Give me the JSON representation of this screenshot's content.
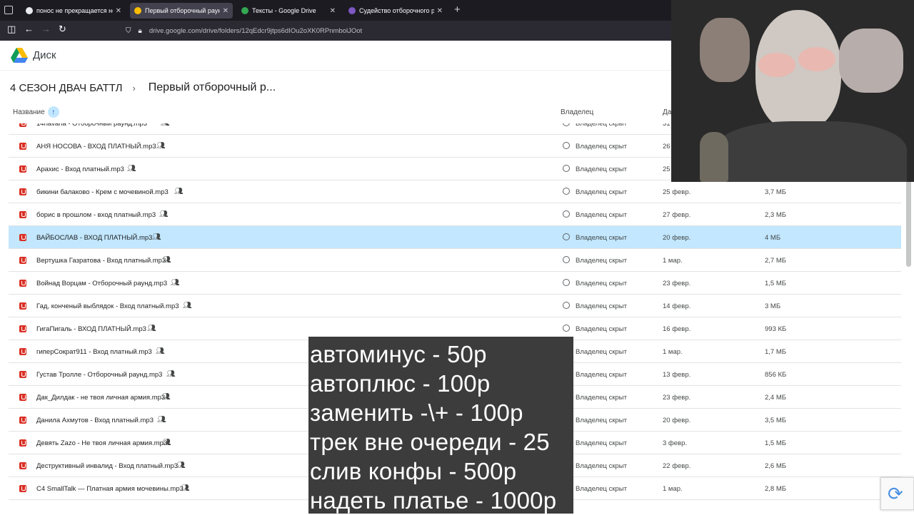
{
  "browser": {
    "tabs": [
      {
        "title": "понос не прекращается неде",
        "favicon_color": "#e8eaed",
        "active": false
      },
      {
        "title": "Первый отборочный раунд – ",
        "favicon_color": "#fbbc04",
        "active": true
      },
      {
        "title": "Тексты - Google Drive",
        "favicon_color": "#34a853",
        "active": false
      },
      {
        "title": "Судейство отборочного раун",
        "favicon_color": "#7e57c2",
        "active": false
      }
    ],
    "url": "drive.google.com/drive/folders/12qEdcr9jtps6dIOu2oXK0RPnmbolJOot"
  },
  "drive": {
    "app_name": "Диск",
    "breadcrumb": {
      "parent": "4 СЕЗОН ДВАЧ БАТТЛ",
      "separator": "›",
      "current": "Первый отборочный р..."
    },
    "columns": {
      "name": "Название",
      "owner": "Владелец",
      "date": "Да"
    },
    "sort_icon": "arrow-up-icon",
    "rows": [
      {
        "name": "14havana - Отборочный раунд.mp3",
        "owner": "Владелец скрыт",
        "date": "31",
        "size": ""
      },
      {
        "name": "АНЯ НОСОВА - ВХОД ПЛАТНЫЙ.mp3",
        "owner": "Владелец скрыт",
        "date": "26",
        "size": ""
      },
      {
        "name": "Арахис - Вход платный.mp3",
        "owner": "Владелец скрыт",
        "date": "25",
        "size": ""
      },
      {
        "name": "бикини балаково - Крем с мочевиной.mp3",
        "owner": "Владелец скрыт",
        "date": "25 февр.",
        "size": "3,7 МБ"
      },
      {
        "name": "борис в прошлом - вход платный.mp3",
        "owner": "Владелец скрыт",
        "date": "27 февр.",
        "size": "2,3 МБ"
      },
      {
        "name": "ВАЙБОСЛАВ - ВХОД ПЛАТНЫЙ.mp3",
        "owner": "Владелец скрыт",
        "date": "20 февр.",
        "size": "4 МБ",
        "selected": true
      },
      {
        "name": "Вертушка Газратова - Вход платный.mp3",
        "owner": "Владелец скрыт",
        "date": "1 мар.",
        "size": "2,7 МБ"
      },
      {
        "name": "Войнад Ворцам - Отборочный раунд.mp3",
        "owner": "Владелец скрыт",
        "date": "23 февр.",
        "size": "1,5 МБ"
      },
      {
        "name": "Гад, конченый выблядок - Вход платный.mp3",
        "owner": "Владелец скрыт",
        "date": "14 февр.",
        "size": "3 МБ"
      },
      {
        "name": "ГигаПигаль - ВХОД ПЛАТНЫЙ.mp3",
        "owner": "Владелец скрыт",
        "date": "16 февр.",
        "size": "993 КБ"
      },
      {
        "name": "гиперСократ911 - Вход платный.mp3",
        "owner": "Владелец скрыт",
        "date": "1 мар.",
        "size": "1,7 МБ"
      },
      {
        "name": "Густав Тролле - Отборочный раунд.mp3",
        "owner": "Владелец скрыт",
        "date": "13 февр.",
        "size": "856 КБ"
      },
      {
        "name": "Дак_Дилдак - не твоя личная армия.mp3",
        "owner": "Владелец скрыт",
        "date": "23 февр.",
        "size": "2,4 МБ"
      },
      {
        "name": "Данила Ахмутов - Вход платный.mp3",
        "owner": "Владелец скрыт",
        "date": "20 февр.",
        "size": "3,5 МБ"
      },
      {
        "name": "Девять Zazo - Не твоя личная армия.mp3",
        "owner": "Владелец скрыт",
        "date": "3 февр.",
        "size": "1,5 МБ"
      },
      {
        "name": "Деструктивный инвалид - Вход платный.mp3",
        "owner": "Владелец скрыт",
        "date": "22 февр.",
        "size": "2,6 МБ"
      },
      {
        "name": "C4 SmallTalk — Платная армия мочевины.mp3",
        "owner": "Владелец скрыт",
        "date": "1 мар.",
        "size": "2,8 МБ"
      }
    ]
  },
  "overlay": {
    "price_lines": [
      "автоминус - 50р",
      "автоплюс - 100р",
      "заменить -\\+ - 100р",
      "трек вне очереди - 25",
      "слив конфы - 500р",
      "надеть платье - 1000р"
    ]
  }
}
